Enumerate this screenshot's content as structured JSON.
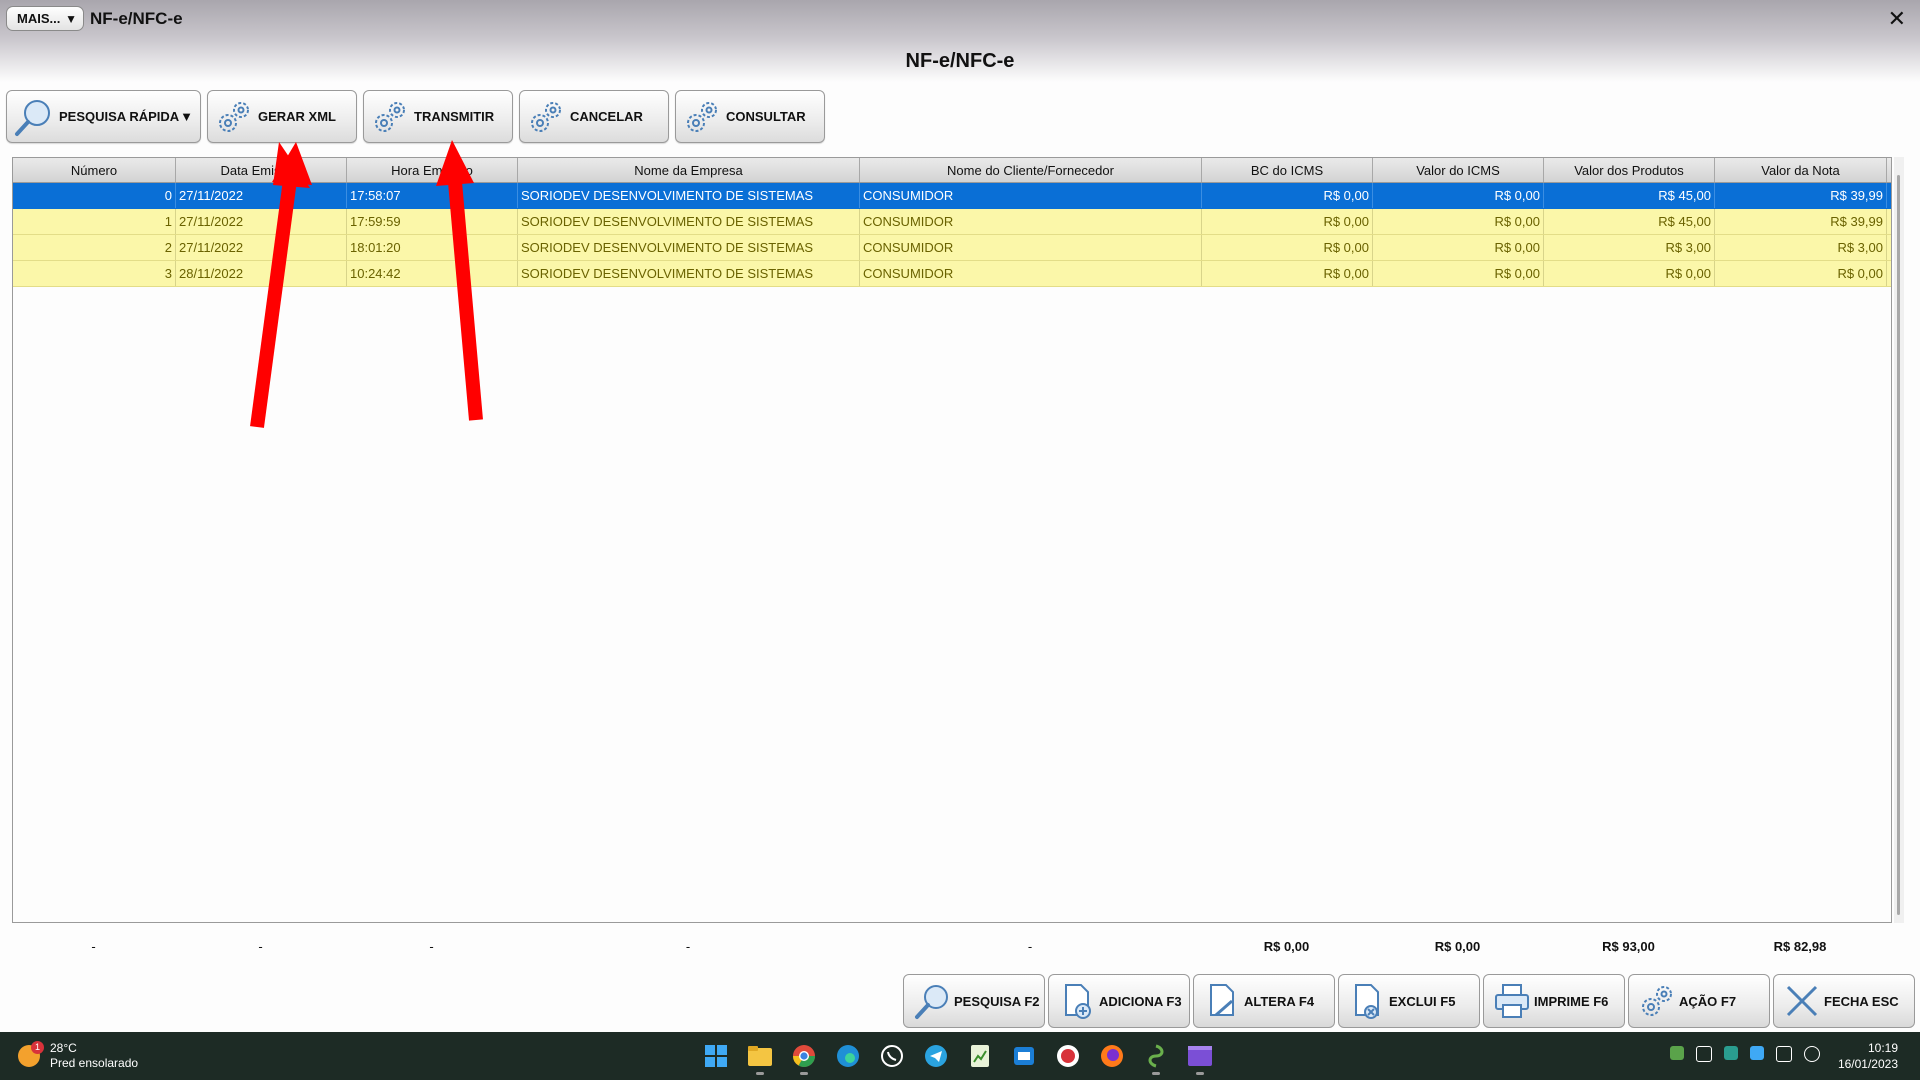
{
  "titlebar": {
    "mais_label": "MAIS...",
    "mais_arrow": "▼",
    "app_title": "NF-e/NFC-e",
    "close_glyph": "✕"
  },
  "heading": "NF-e/NFC-e",
  "toolbar": {
    "pesquisa_rapida": "PESQUISA RÁPIDA",
    "pesquisa_dropdown": "▼",
    "gerar_xml": "GERAR XML",
    "transmitir": "TRANSMITIR",
    "cancelar": "CANCELAR",
    "consultar": "CONSULTAR"
  },
  "table": {
    "columns": [
      "Número",
      "Data Emissão",
      "Hora Emissão",
      "Nome da Empresa",
      "Nome do Cliente/Fornecedor",
      "BC do ICMS",
      "Valor do ICMS",
      "Valor dos Produtos",
      "Valor da Nota"
    ],
    "rows": [
      [
        "0",
        "27/11/2022",
        "17:58:07",
        "SORIODEV DESENVOLVIMENTO DE SISTEMAS",
        "CONSUMIDOR",
        "R$ 0,00",
        "R$ 0,00",
        "R$ 45,00",
        "R$ 39,99"
      ],
      [
        "1",
        "27/11/2022",
        "17:59:59",
        "SORIODEV DESENVOLVIMENTO DE SISTEMAS",
        "CONSUMIDOR",
        "R$ 0,00",
        "R$ 0,00",
        "R$ 45,00",
        "R$ 39,99"
      ],
      [
        "2",
        "27/11/2022",
        "18:01:20",
        "SORIODEV DESENVOLVIMENTO DE SISTEMAS",
        "CONSUMIDOR",
        "R$ 0,00",
        "R$ 0,00",
        "R$ 3,00",
        "R$ 3,00"
      ],
      [
        "3",
        "28/11/2022",
        "10:24:42",
        "SORIODEV DESENVOLVIMENTO DE SISTEMAS",
        "CONSUMIDOR",
        "R$ 0,00",
        "R$ 0,00",
        "R$ 0,00",
        "R$ 0,00"
      ]
    ],
    "selected_row": 0
  },
  "totals": [
    "-",
    "-",
    "-",
    "-",
    "-",
    "R$ 0,00",
    "R$ 0,00",
    "R$ 93,00",
    "R$ 82,98"
  ],
  "bottom_buttons": {
    "pesquisa": "PESQUISA F2",
    "adiciona": "ADICIONA F3",
    "altera": "ALTERA F4",
    "exclui": "EXCLUI F5",
    "imprime": "IMPRIME F6",
    "acao": "AÇÃO F7",
    "fecha": "FECHA ESC"
  },
  "taskbar": {
    "weather_badge": "1",
    "weather_temp": "28°C",
    "weather_desc": "Pred ensolarado",
    "time": "10:19",
    "date": "16/01/2023",
    "icons": [
      "windows-start-icon",
      "file-explorer-icon",
      "chrome-icon",
      "edge-icon",
      "whatsapp-icon",
      "telegram-icon",
      "spreadsheet-app-icon",
      "outlook-icon",
      "app-red-icon",
      "firefox-icon",
      "app-green-icon",
      "app-purple-icon"
    ]
  },
  "colors": {
    "selected_row": "#0a6fd6",
    "row_highlight": "#fbf7a9",
    "row_text": "#6a6200",
    "annotation_arrow": "#ff0000"
  }
}
